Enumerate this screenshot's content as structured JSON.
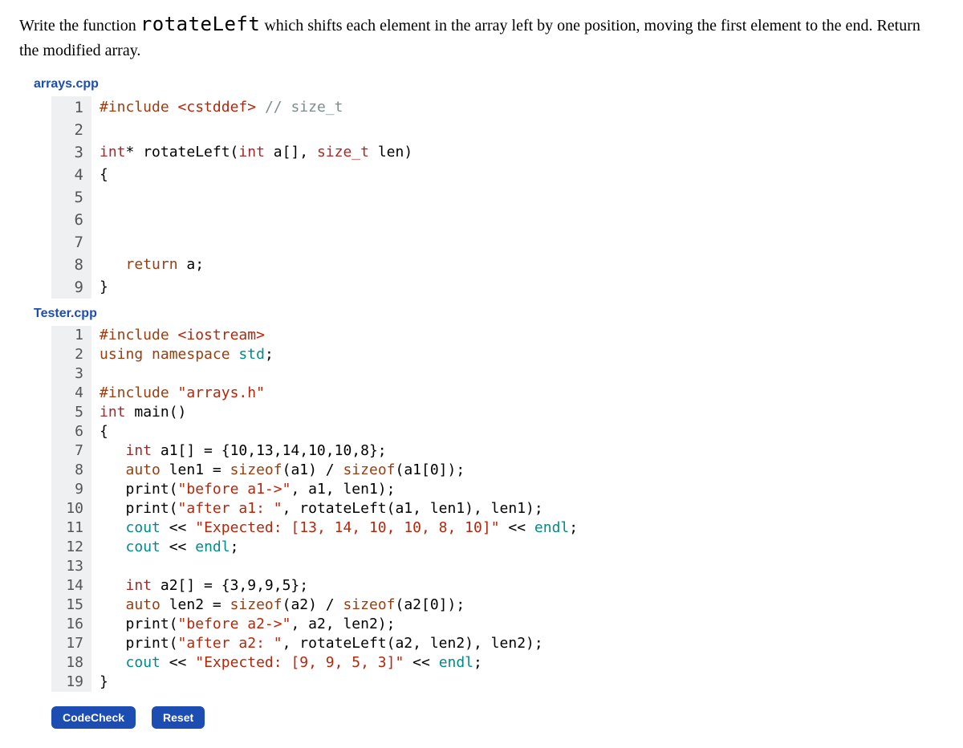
{
  "prompt": {
    "pre": "Write the function ",
    "fn": "rotateLeft",
    "post": " which shifts each element in the array left by one position, moving the first element to the end. Return the modified array."
  },
  "file1": {
    "name": "arrays.cpp",
    "lines": [
      {
        "n": "1",
        "editable": false,
        "html": "<span class='tok-pp'>#include</span> <span class='tok-str'>&lt;cstddef&gt;</span> <span class='tok-cmt'>// size_t</span>"
      },
      {
        "n": "2",
        "editable": false,
        "html": ""
      },
      {
        "n": "3",
        "editable": false,
        "html": "<span class='tok-type'>int</span>* rotateLeft(<span class='tok-type'>int</span> a[], <span class='tok-type'>size_t</span> len)"
      },
      {
        "n": "4",
        "editable": false,
        "html": "{"
      },
      {
        "n": "5",
        "editable": true,
        "html": ""
      },
      {
        "n": "6",
        "editable": true,
        "html": ""
      },
      {
        "n": "7",
        "editable": true,
        "html": ""
      },
      {
        "n": "8",
        "editable": false,
        "html": "   <span class='tok-kw'>return</span> a;"
      },
      {
        "n": "9",
        "editable": false,
        "html": "}"
      }
    ]
  },
  "file2": {
    "name": "Tester.cpp",
    "lines": [
      {
        "n": "1",
        "html": "<span class='tok-pp'>#include</span> <span class='tok-str'>&lt;iostream&gt;</span>"
      },
      {
        "n": "2",
        "html": "<span class='tok-kw'>using</span> <span class='tok-kw'>namespace</span> <span class='tok-std'>std</span>;"
      },
      {
        "n": "3",
        "html": ""
      },
      {
        "n": "4",
        "html": "<span class='tok-pp'>#include</span> <span class='tok-str'>\"arrays.h\"</span>"
      },
      {
        "n": "5",
        "html": "<span class='tok-type'>int</span> main()"
      },
      {
        "n": "6",
        "html": "{"
      },
      {
        "n": "7",
        "html": "   <span class='tok-type'>int</span> a1[] = {10,13,14,10,10,8};"
      },
      {
        "n": "8",
        "html": "   <span class='tok-kw'>auto</span> len1 = <span class='tok-kw'>sizeof</span>(a1) / <span class='tok-kw'>sizeof</span>(a1[0]);"
      },
      {
        "n": "9",
        "html": "   print(<span class='tok-str'>\"before a1-&gt;\"</span>, a1, len1);"
      },
      {
        "n": "10",
        "html": "   print(<span class='tok-str'>\"after a1: \"</span>, rotateLeft(a1, len1), len1);"
      },
      {
        "n": "11",
        "html": "   <span class='tok-std'>cout</span> &lt;&lt; <span class='tok-str'>\"Expected: [13, 14, 10, 10, 8, 10]\"</span> &lt;&lt; <span class='tok-std'>endl</span>;"
      },
      {
        "n": "12",
        "html": "   <span class='tok-std'>cout</span> &lt;&lt; <span class='tok-std'>endl</span>;"
      },
      {
        "n": "13",
        "html": ""
      },
      {
        "n": "14",
        "html": "   <span class='tok-type'>int</span> a2[] = {3,9,9,5};"
      },
      {
        "n": "15",
        "html": "   <span class='tok-kw'>auto</span> len2 = <span class='tok-kw'>sizeof</span>(a2) / <span class='tok-kw'>sizeof</span>(a2[0]);"
      },
      {
        "n": "16",
        "html": "   print(<span class='tok-str'>\"before a2-&gt;\"</span>, a2, len2);"
      },
      {
        "n": "17",
        "html": "   print(<span class='tok-str'>\"after a2: \"</span>, rotateLeft(a2, len2), len2);"
      },
      {
        "n": "18",
        "html": "   <span class='tok-std'>cout</span> &lt;&lt; <span class='tok-str'>\"Expected: [9, 9, 5, 3]\"</span> &lt;&lt; <span class='tok-std'>endl</span>;"
      },
      {
        "n": "19",
        "html": "}"
      }
    ]
  },
  "buttons": {
    "codecheck": "CodeCheck",
    "reset": "Reset"
  }
}
